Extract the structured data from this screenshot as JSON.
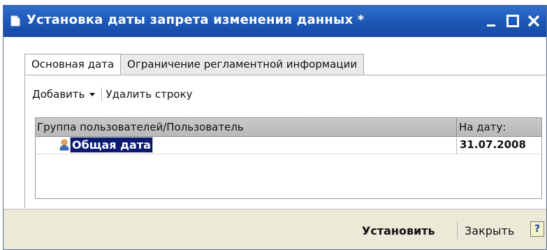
{
  "window": {
    "title": "Установка даты запрета изменения данных *",
    "controls": [
      "minimize",
      "maximize",
      "close"
    ]
  },
  "tabs": [
    {
      "label": "Основная дата",
      "active": true
    },
    {
      "label": "Ограничение регламентной информации",
      "active": false
    }
  ],
  "toolbar": {
    "add_label": "Добавить",
    "delete_label": "Удалить строку"
  },
  "table": {
    "columns": [
      "Группа пользователей/Пользователь",
      "На дату:"
    ],
    "rows": [
      {
        "name": "Общая дата",
        "date": "31.07.2008"
      }
    ]
  },
  "footer": {
    "set_label": "Установить",
    "close_label": "Закрыть",
    "help_label": "?"
  },
  "colors": {
    "titlebar": "#1c57b6",
    "selection": "#0a1a6e",
    "footer_bg": "#ece9d8"
  }
}
